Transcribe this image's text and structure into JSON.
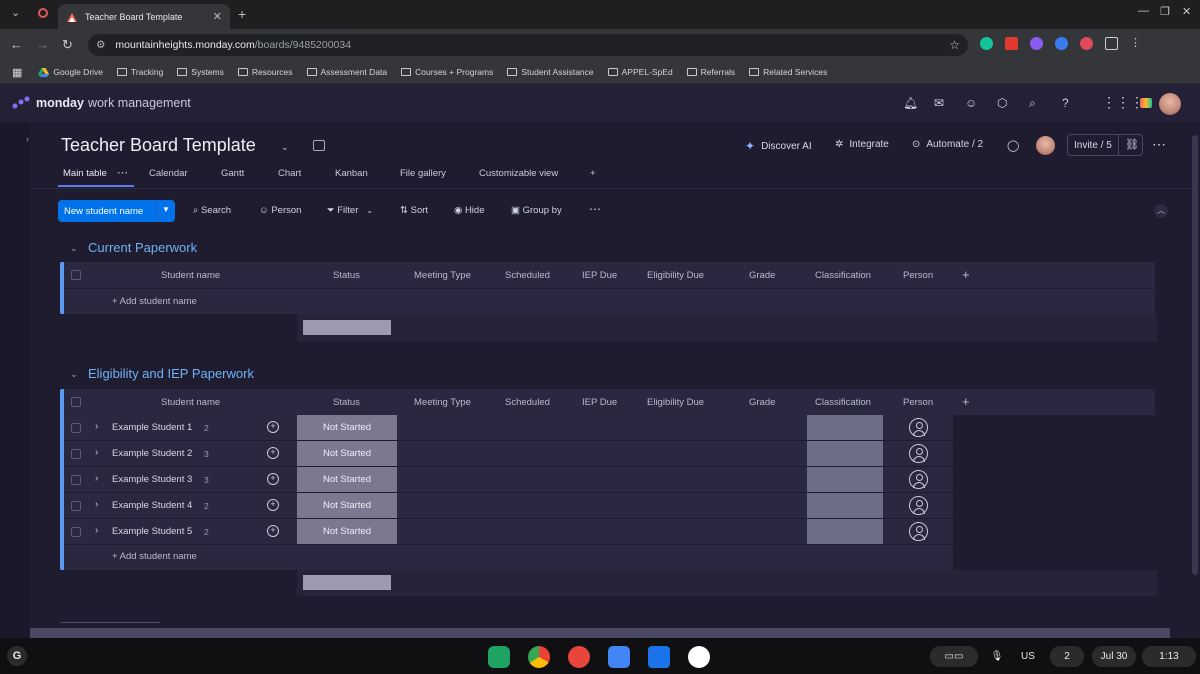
{
  "browser": {
    "tab_title": "Teacher Board Template",
    "url_host": "mountainheights.monday.com",
    "url_path": "/boards/9485200034",
    "bookmarks": [
      "Google Drive",
      "Tracking",
      "Systems",
      "Resources",
      "Assessment Data",
      "Courses + Programs",
      "Student Assistance",
      "APPEL-SpEd",
      "Referrals",
      "Related Services"
    ]
  },
  "app": {
    "brand": "monday",
    "brand_sub": "work management"
  },
  "board": {
    "title": "Teacher Board Template",
    "discover_ai": "Discover AI",
    "integrate": "Integrate",
    "automate": "Automate / 2",
    "invite": "Invite / 5",
    "views": [
      "Main table",
      "Calendar",
      "Gantt",
      "Chart",
      "Kanban",
      "File gallery",
      "Customizable view"
    ],
    "add_view": "+"
  },
  "toolbar": {
    "new_item": "New student name",
    "search": "Search",
    "person": "Person",
    "filter": "Filter",
    "sort": "Sort",
    "hide": "Hide",
    "group_by": "Group by"
  },
  "columns": [
    "Student name",
    "Status",
    "Meeting Type",
    "Scheduled",
    "IEP Due",
    "Eligibility Due",
    "Grade",
    "Classification",
    "Person"
  ],
  "groups": [
    {
      "title": "Current Paperwork",
      "add_row": "+ Add student name",
      "rows": []
    },
    {
      "title": "Eligibility and IEP Paperwork",
      "add_row": "+ Add student name",
      "rows": [
        {
          "name": "Example Student 1",
          "count": "2",
          "status": "Not Started"
        },
        {
          "name": "Example Student 2",
          "count": "3",
          "status": "Not Started"
        },
        {
          "name": "Example Student 3",
          "count": "3",
          "status": "Not Started"
        },
        {
          "name": "Example Student 4",
          "count": "2",
          "status": "Not Started"
        },
        {
          "name": "Example Student 5",
          "count": "2",
          "status": "Not Started"
        }
      ]
    }
  ],
  "taskbar": {
    "launcher": "G",
    "keyboard": "US",
    "notif_count": "2",
    "date": "Jul 30",
    "time": "1:13"
  },
  "colors": {
    "accent": "#0073ea",
    "group_title": "#6fb2f5",
    "status_not_started": "#7a7990"
  }
}
